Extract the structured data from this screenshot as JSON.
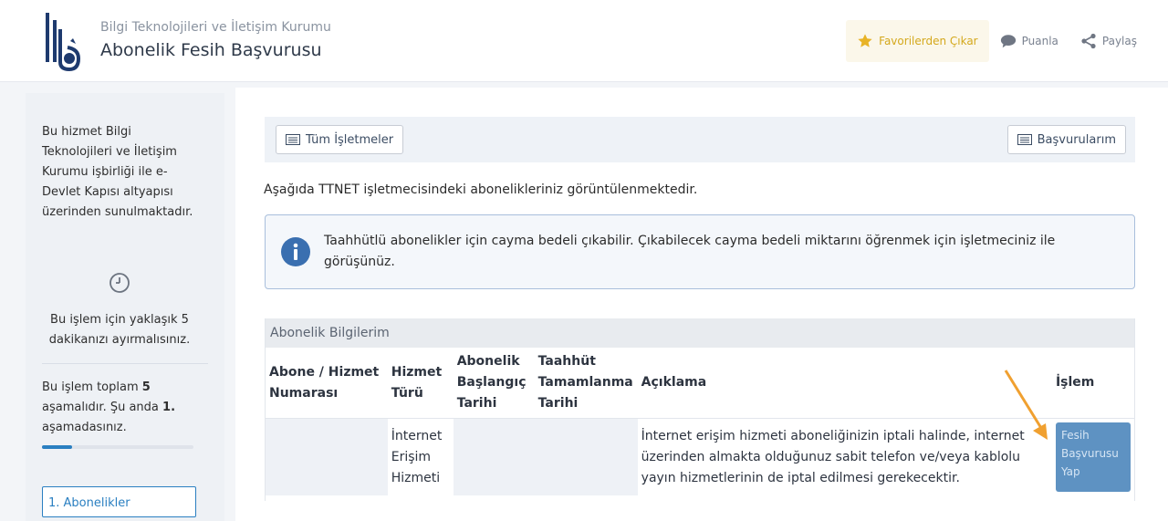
{
  "header": {
    "org_name": "Bilgi Teknolojileri ve İletişim Kurumu",
    "page_title": "Abonelik Fesih Başvurusu",
    "actions": [
      {
        "label": "Favorilerden Çıkar",
        "icon": "star-icon"
      },
      {
        "label": "Puanla",
        "icon": "speech-bubble-icon"
      },
      {
        "label": "Paylaş",
        "icon": "share-icon"
      }
    ]
  },
  "sidebar": {
    "service_text": "Bu hizmet Bilgi Teknolojileri ve İletişim Kurumu işbirliği ile e-Devlet Kapısı altyapısı üzerinden sunulmaktadır.",
    "duration_text": "Bu işlem için yaklaşık 5 dakikanızı ayırmalısınız.",
    "steps": {
      "prefix": "Bu işlem toplam ",
      "total": "5",
      "middle": " aşamalıdır. Şu anda ",
      "current": "1.",
      "suffix": " aşamadasınız."
    },
    "progress_fraction": 0.2,
    "current_step_label": "1. Abonelikler"
  },
  "toolbar": {
    "all_operators": "Tüm İşletmeler",
    "my_applications": "Başvurularım"
  },
  "main": {
    "intro": "Aşağıda TTNET işletmecisindeki abonelikleriniz görüntülenmektedir.",
    "info": "Taahhütlü abonelikler için cayma bedeli çıkabilir. Çıkabilecek cayma bedeli miktarını öğrenmek için işletmeciniz ile görüşünüz."
  },
  "table": {
    "title": "Abonelik Bilgilerim",
    "columns": [
      "Abone / Hizmet Numarası",
      "Hizmet Türü",
      "Abonelik Başlangıç Tarihi",
      "Taahhüt Tamamlanma Tarihi",
      "Açıklama",
      "İşlem"
    ],
    "rows": [
      {
        "number": "",
        "service_type": "İnternet Erişim Hizmeti",
        "start_date": "",
        "commitment_end": "",
        "description": "İnternet erişim hizmeti aboneliğinizin iptali halinde, internet üzerinden almakta olduğunuz sabit telefon ve/veya kablolu yayın hizmetlerinin de iptal edilmesi gerekecektir.",
        "action": "Fesih Başvurusu Yap"
      }
    ]
  },
  "colors": {
    "accent": "#2a7fc1",
    "favorite": "#d4a81c",
    "action_button": "#5e92c2",
    "arrow": "#f0a030"
  }
}
